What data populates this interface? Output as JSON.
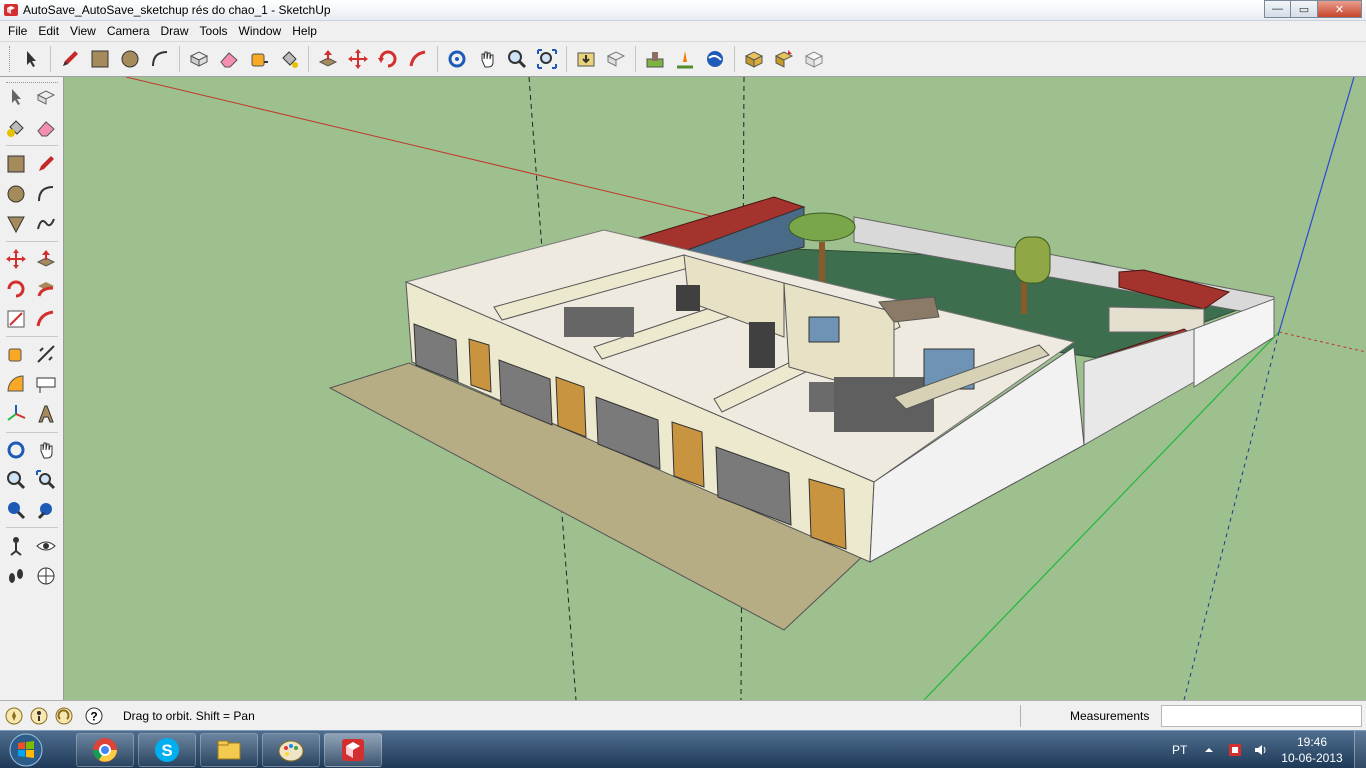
{
  "window": {
    "title": "AutoSave_AutoSave_sketchup rés do chao_1 - SketchUp",
    "controls": {
      "minimize": "—",
      "maximize": "▭",
      "close": "✕"
    }
  },
  "menu": {
    "items": [
      "File",
      "Edit",
      "View",
      "Camera",
      "Draw",
      "Tools",
      "Window",
      "Help"
    ]
  },
  "toolbar": {
    "tools": [
      "select-icon",
      "pencil-icon",
      "rectangle-icon",
      "circle-icon",
      "arc-icon",
      "make-component-icon",
      "eraser-icon",
      "tape-measure-icon",
      "paint-bucket-icon",
      "push-pull-icon",
      "move-icon",
      "rotate-icon",
      "follow-me-icon",
      "orbit-icon",
      "pan-icon",
      "zoom-icon",
      "zoom-extents-icon",
      "get-models-icon",
      "share-model-icon",
      "get-photo-texture-icon",
      "add-location-icon",
      "toggle-terrain-icon",
      "google-earth-icon",
      "components-get-icon",
      "components-share-icon",
      "extension-warehouse-icon"
    ]
  },
  "status": {
    "message": "Drag to orbit.  Shift = Pan",
    "measurements_label": "Measurements",
    "measurements_value": ""
  },
  "taskbar": {
    "apps": [
      "chrome-icon",
      "skype-icon",
      "file-explorer-icon",
      "paint-icon",
      "sketchup-icon"
    ],
    "active_app": "sketchup-icon",
    "language": "PT",
    "time": "19:46",
    "date": "10-06-2013"
  },
  "colors": {
    "viewport_background": "#9ebf8e",
    "wall": "#ede9cf",
    "roof": "#a3332c",
    "lawn": "#3d6e4e",
    "ground_pavement": "#b7ad84",
    "axis_red": "#c0392b",
    "axis_green": "#1fb83f",
    "axis_blue": "#2b4ad6"
  }
}
